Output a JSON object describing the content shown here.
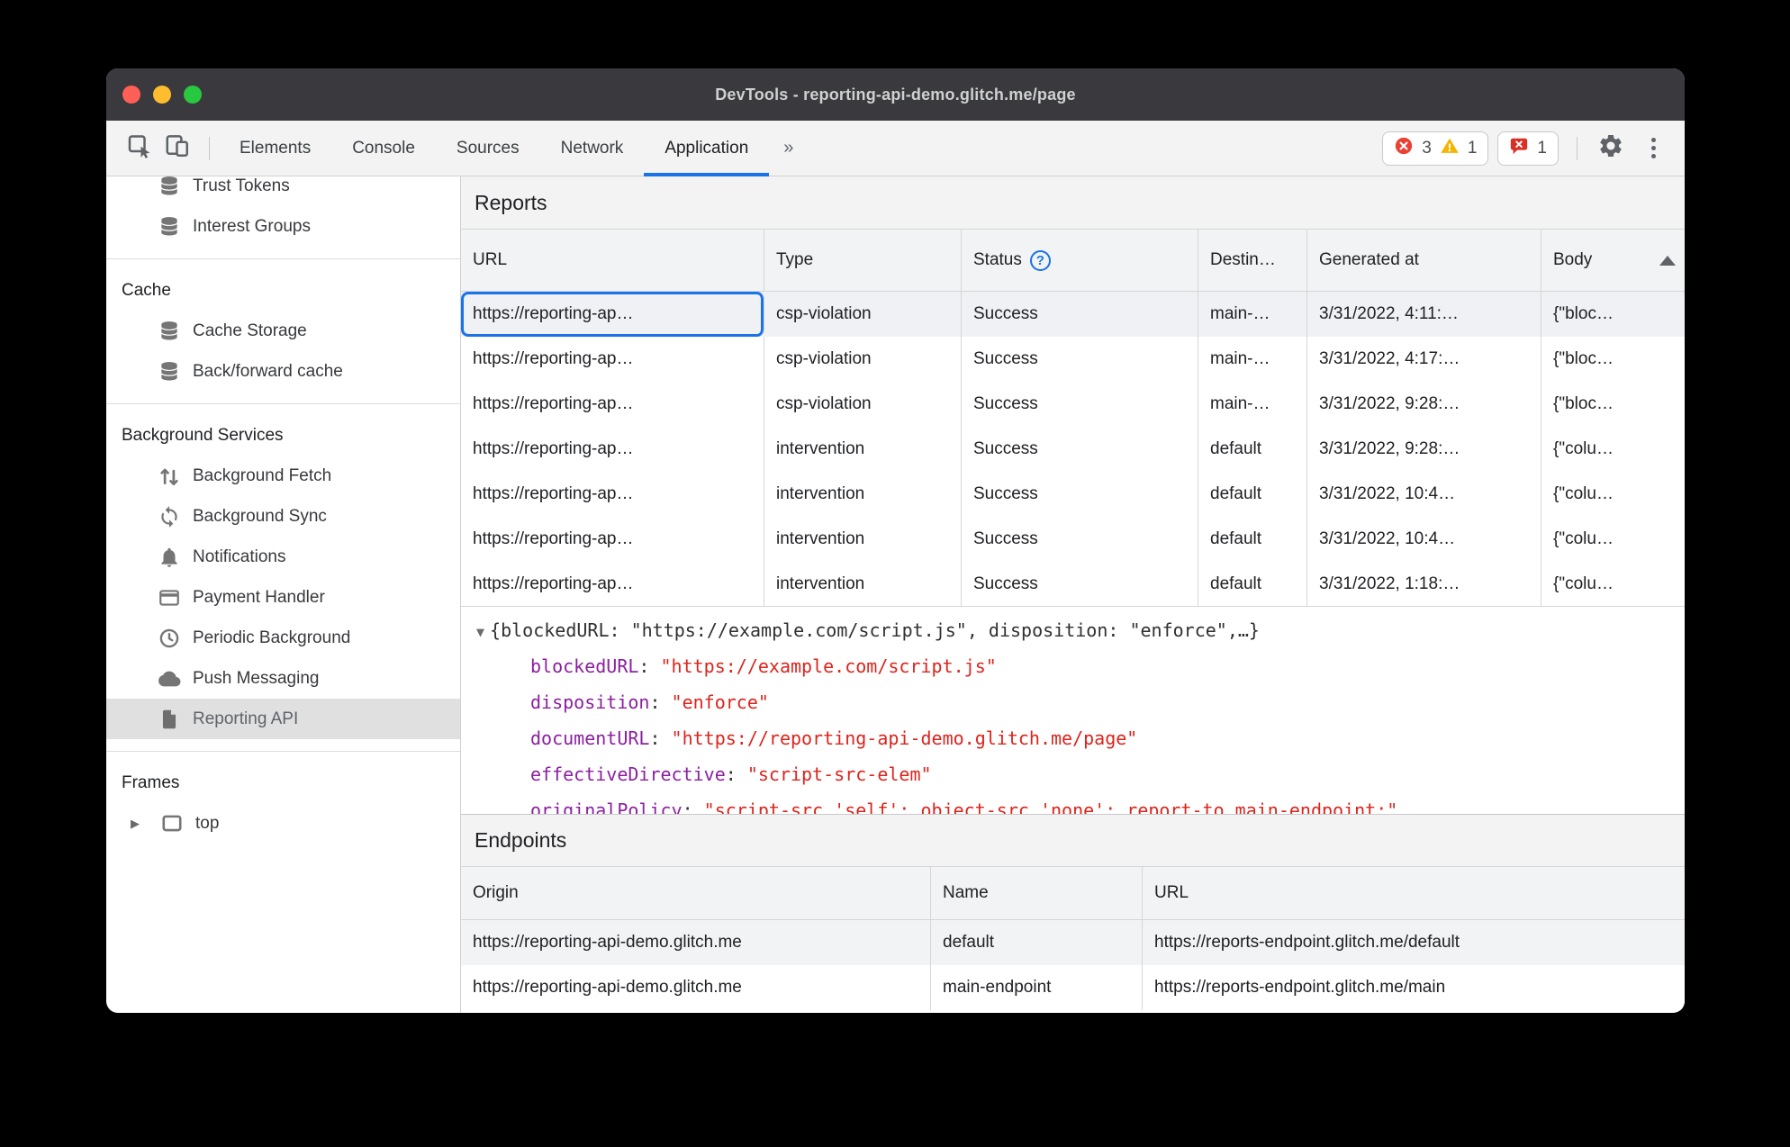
{
  "colors": {
    "accent_blue": "#1a73e8",
    "error_red": "#e94235",
    "warning_yellow": "#f5b400",
    "issues_red": "#d93025",
    "json_key_purple": "#8b1fa0",
    "json_string_red": "#dc241c",
    "selected_sidebar_bg": "#e0e0e0",
    "titlebar_bg": "#3a3a3e"
  },
  "titlebar": {
    "title": "DevTools - reporting-api-demo.glitch.me/page"
  },
  "toolbar": {
    "tabs": [
      {
        "label": "Elements"
      },
      {
        "label": "Console"
      },
      {
        "label": "Sources"
      },
      {
        "label": "Network"
      },
      {
        "label": "Application"
      }
    ],
    "active_tab": "Application",
    "more_tabs": "»",
    "error_count": "3",
    "warning_count": "1",
    "issue_count": "1"
  },
  "sidebar": {
    "top_items": [
      {
        "label": "Trust Tokens",
        "icon": "database-icon"
      },
      {
        "label": "Interest Groups",
        "icon": "database-icon"
      }
    ],
    "cache_section": {
      "title": "Cache",
      "items": [
        {
          "label": "Cache Storage",
          "icon": "database-icon"
        },
        {
          "label": "Back/forward cache",
          "icon": "database-icon"
        }
      ]
    },
    "background_section": {
      "title": "Background Services",
      "items": [
        {
          "label": "Background Fetch",
          "icon": "up-down-arrows-icon"
        },
        {
          "label": "Background Sync",
          "icon": "sync-icon"
        },
        {
          "label": "Notifications",
          "icon": "bell-icon"
        },
        {
          "label": "Payment Handler",
          "icon": "card-icon"
        },
        {
          "label": "Periodic Background",
          "icon": "clock-icon"
        },
        {
          "label": "Push Messaging",
          "icon": "cloud-icon"
        },
        {
          "label": "Reporting API",
          "icon": "file-icon",
          "selected": true
        }
      ]
    },
    "frames_section": {
      "title": "Frames",
      "items": [
        {
          "label": "top",
          "icon": "frame-icon"
        }
      ]
    }
  },
  "reports": {
    "section_title": "Reports",
    "columns": [
      "URL",
      "Type",
      "Status",
      "Destin…",
      "Generated at",
      "Body"
    ],
    "rows": [
      {
        "url": "https://reporting-ap…",
        "type": "csp-violation",
        "status": "Success",
        "destination": "main-…",
        "generated_at": "3/31/2022, 4:11:…",
        "body": "{\"bloc…"
      },
      {
        "url": "https://reporting-ap…",
        "type": "csp-violation",
        "status": "Success",
        "destination": "main-…",
        "generated_at": "3/31/2022, 4:17:…",
        "body": "{\"bloc…"
      },
      {
        "url": "https://reporting-ap…",
        "type": "csp-violation",
        "status": "Success",
        "destination": "main-…",
        "generated_at": "3/31/2022, 9:28:…",
        "body": "{\"bloc…"
      },
      {
        "url": "https://reporting-ap…",
        "type": "intervention",
        "status": "Success",
        "destination": "default",
        "generated_at": "3/31/2022, 9:28:…",
        "body": "{\"colu…"
      },
      {
        "url": "https://reporting-ap…",
        "type": "intervention",
        "status": "Success",
        "destination": "default",
        "generated_at": "3/31/2022, 10:4…",
        "body": "{\"colu…"
      },
      {
        "url": "https://reporting-ap…",
        "type": "intervention",
        "status": "Success",
        "destination": "default",
        "generated_at": "3/31/2022, 10:4…",
        "body": "{\"colu…"
      },
      {
        "url": "https://reporting-ap…",
        "type": "intervention",
        "status": "Success",
        "destination": "default",
        "generated_at": "3/31/2022, 1:18:…",
        "body": "{\"colu…"
      }
    ]
  },
  "report_preview": {
    "summary": "{blockedURL: \"https://example.com/script.js\", disposition: \"enforce\",…}",
    "fields": [
      {
        "key": "blockedURL",
        "value": "\"https://example.com/script.js\""
      },
      {
        "key": "disposition",
        "value": "\"enforce\""
      },
      {
        "key": "documentURL",
        "value": "\"https://reporting-api-demo.glitch.me/page\""
      },
      {
        "key": "effectiveDirective",
        "value": "\"script-src-elem\""
      },
      {
        "key": "originalPolicy",
        "value": "\"script-src 'self'; object-src 'none'; report-to main-endpoint;\""
      }
    ]
  },
  "endpoints": {
    "section_title": "Endpoints",
    "columns": [
      "Origin",
      "Name",
      "URL"
    ],
    "rows": [
      {
        "origin": "https://reporting-api-demo.glitch.me",
        "name": "default",
        "url": "https://reports-endpoint.glitch.me/default"
      },
      {
        "origin": "https://reporting-api-demo.glitch.me",
        "name": "main-endpoint",
        "url": "https://reports-endpoint.glitch.me/main"
      }
    ]
  }
}
